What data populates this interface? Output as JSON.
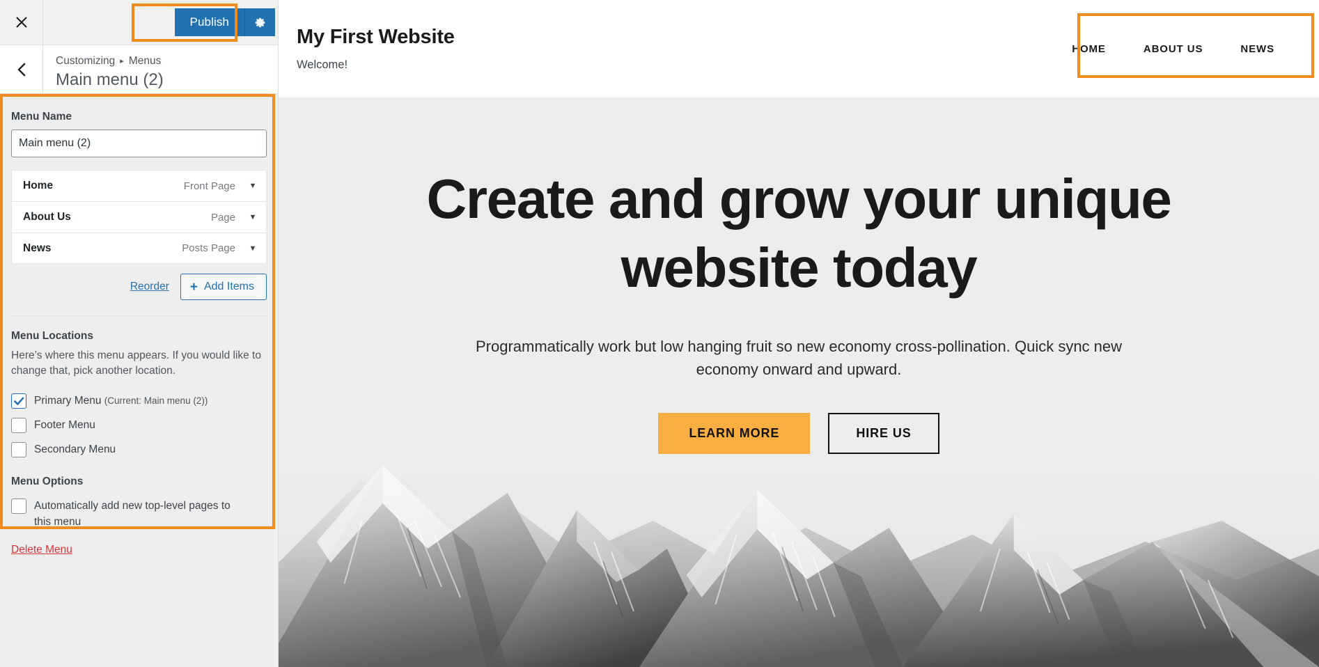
{
  "customizer": {
    "close_icon": "close-x-icon",
    "publish": {
      "label": "Publish",
      "gear_icon": "gear-icon"
    },
    "back_icon": "chevron-left-icon",
    "breadcrumb": {
      "root": "Customizing",
      "separator": "▸",
      "current": "Menus"
    },
    "panel_title": "Main menu (2)",
    "menu_name": {
      "label": "Menu Name",
      "value": "Main menu (2)",
      "placeholder": "Menu Name"
    },
    "menu_items": [
      {
        "title": "Home",
        "type": "Front Page",
        "caret": "▼"
      },
      {
        "title": "About Us",
        "type": "Page",
        "caret": "▼"
      },
      {
        "title": "News",
        "type": "Posts Page",
        "caret": "▼"
      }
    ],
    "actions": {
      "reorder": "Reorder",
      "add_items": "Add Items",
      "plus_icon": "+"
    },
    "menu_locations": {
      "title": "Menu Locations",
      "description": "Here’s where this menu appears. If you would like to change that, pick another location.",
      "options": [
        {
          "label": "Primary Menu",
          "current": "(Current: Main menu (2))",
          "checked": true
        },
        {
          "label": "Footer Menu",
          "current": "",
          "checked": false
        },
        {
          "label": "Secondary Menu",
          "current": "",
          "checked": false
        }
      ]
    },
    "menu_options": {
      "title": "Menu Options",
      "options": [
        {
          "label": "Automatically add new top-level pages to this menu",
          "checked": false
        }
      ]
    },
    "delete_menu": "Delete Menu"
  },
  "preview": {
    "site_title": "My First Website",
    "tagline": "Welcome!",
    "nav": [
      {
        "label": "HOME"
      },
      {
        "label": "ABOUT US"
      },
      {
        "label": "NEWS"
      }
    ],
    "hero": {
      "title": "Create and grow your unique website today",
      "subtitle": "Programmatically work but low hanging fruit so new economy cross-pollination. Quick sync new economy onward and upward.",
      "primary_button": "LEARN MORE",
      "secondary_button": "HIRE US"
    }
  },
  "colors": {
    "publish_blue": "#2271b1",
    "annotation_orange": "#f08b1d",
    "hero_button_orange": "#f9ae42",
    "delete_red": "#d63638",
    "link_blue": "#2271b1"
  }
}
